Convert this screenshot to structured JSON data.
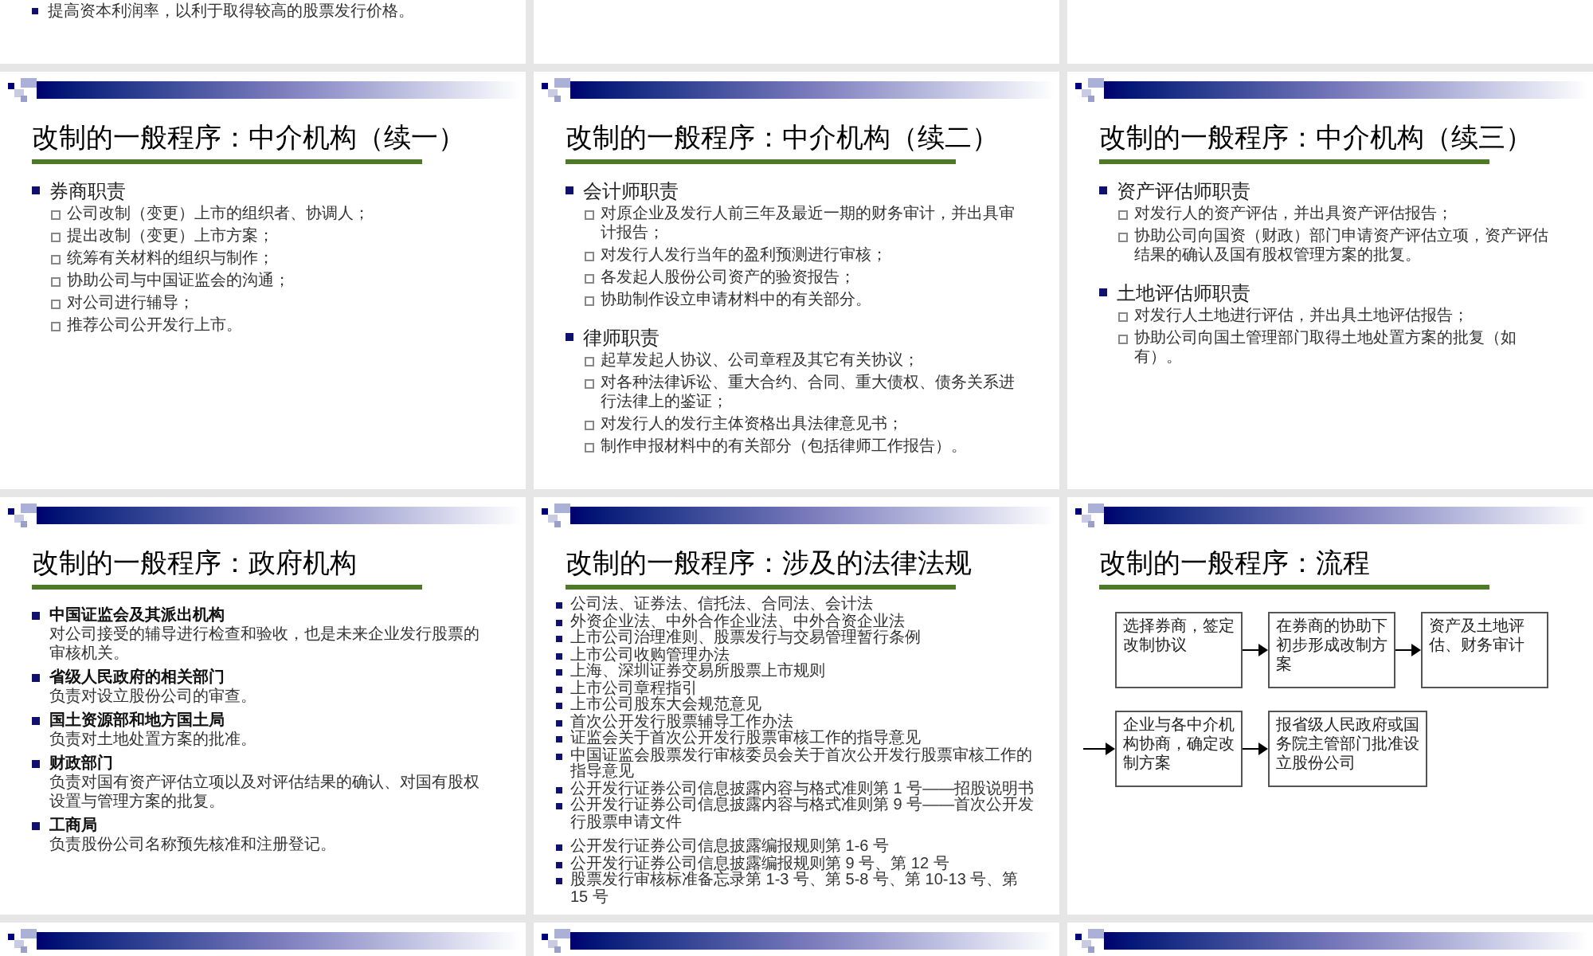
{
  "rows": [
    {
      "slides": [
        {
          "kind": "bullets",
          "items": [
            "提高资本利润率，以利于取得较高的股票发行价格。"
          ]
        },
        {
          "kind": "blank"
        },
        {
          "kind": "blank"
        }
      ]
    },
    {
      "slides": [
        {
          "kind": "outline",
          "title": "改制的一般程序：中介机构（续一）",
          "sections": [
            {
              "heading": "券商职责",
              "items": [
                "公司改制（变更）上市的组织者、协调人；",
                "提出改制（变更）上市方案；",
                "统筹有关材料的组织与制作；",
                "协助公司与中国证监会的沟通；",
                "对公司进行辅导；",
                "推荐公司公开发行上市。"
              ]
            }
          ]
        },
        {
          "kind": "outline",
          "title": "改制的一般程序：中介机构（续二）",
          "sections": [
            {
              "heading": "会计师职责",
              "items": [
                "对原企业及发行人前三年及最近一期的财务审计，并出具审计报告；",
                "对发行人发行当年的盈利预测进行审核；",
                "各发起人股份公司资产的验资报告；",
                "协助制作设立申请材料中的有关部分。"
              ]
            },
            {
              "heading": "律师职责",
              "items": [
                "起草发起人协议、公司章程及其它有关协议；",
                "对各种法律诉讼、重大合约、合同、重大债权、债务关系进行法律上的鉴证；",
                "对发行人的发行主体资格出具法律意见书；",
                "制作申报材料中的有关部分（包括律师工作报告）。"
              ]
            }
          ]
        },
        {
          "kind": "outline",
          "title": "改制的一般程序：中介机构（续三）",
          "sections": [
            {
              "heading": "资产评估师职责",
              "items": [
                "对发行人的资产评估，并出具资产评估报告；",
                "协助公司向国资（财政）部门申请资产评估立项，资产评估结果的确认及国有股权管理方案的批复。"
              ]
            },
            {
              "heading": "土地评估师职责",
              "items": [
                "对发行人土地进行评估，并出具土地评估报告；",
                "协助公司向国土管理部门取得土地处置方案的批复（如有）。"
              ]
            }
          ]
        }
      ]
    },
    {
      "slides": [
        {
          "kind": "agencies",
          "title": "改制的一般程序：政府机构",
          "entries": [
            {
              "heading": "中国证监会及其派出机构",
              "text": "对公司接受的辅导进行检查和验收，也是未来企业发行股票的审核机关。"
            },
            {
              "heading": "省级人民政府的相关部门",
              "text": "负责对设立股份公司的审查。"
            },
            {
              "heading": "国土资源部和地方国土局",
              "text": "负责对土地处置方案的批准。"
            },
            {
              "heading": "财政部门",
              "text": "负责对国有资产评估立项以及对评估结果的确认、对国有股权设置与管理方案的批复。"
            },
            {
              "heading": "工商局",
              "text": "负责股份公司名称预先核准和注册登记。"
            }
          ]
        },
        {
          "kind": "list",
          "title": "改制的一般程序：涉及的法律法规",
          "groups": [
            [
              "公司法、证券法、信托法、合同法、会计法",
              "外资企业法、中外合作企业法、中外合资企业法",
              "上市公司治理准则、股票发行与交易管理暂行条例",
              "上市公司收购管理办法",
              "上海、深圳证券交易所股票上市规则",
              "上市公司章程指引",
              "上市公司股东大会规范意见",
              "首次公开发行股票辅导工作办法",
              "证监会关于首次公开发行股票审核工作的指导意见",
              "中国证监会股票发行审核委员会关于首次公开发行股票审核工作的指导意见",
              "公开发行证券公司信息披露内容与格式准则第 1 号——招股说明书",
              "公开发行证券公司信息披露内容与格式准则第 9 号——首次公开发行股票申请文件"
            ],
            [
              "公开发行证券公司信息披露编报规则第 1-6 号",
              "公开发行证券公司信息披露编报规则第 9 号、第 12 号",
              "股票发行审核标准备忘录第 1-3 号、第 5-8 号、第 10-13 号、第 15 号"
            ]
          ]
        },
        {
          "kind": "flowchart",
          "title": "改制的一般程序：流程",
          "nodes": [
            "选择券商，签定改制协议",
            "在券商的协助下初步形成改制方案",
            "资产及土地评估、财务审计",
            "企业与各中介机构协商，确定改制方案",
            "报省级人民政府或国务院主管部门批准设立股份公司"
          ]
        }
      ]
    },
    {
      "slides": [
        {
          "kind": "header"
        },
        {
          "kind": "header"
        },
        {
          "kind": "header"
        }
      ]
    }
  ]
}
